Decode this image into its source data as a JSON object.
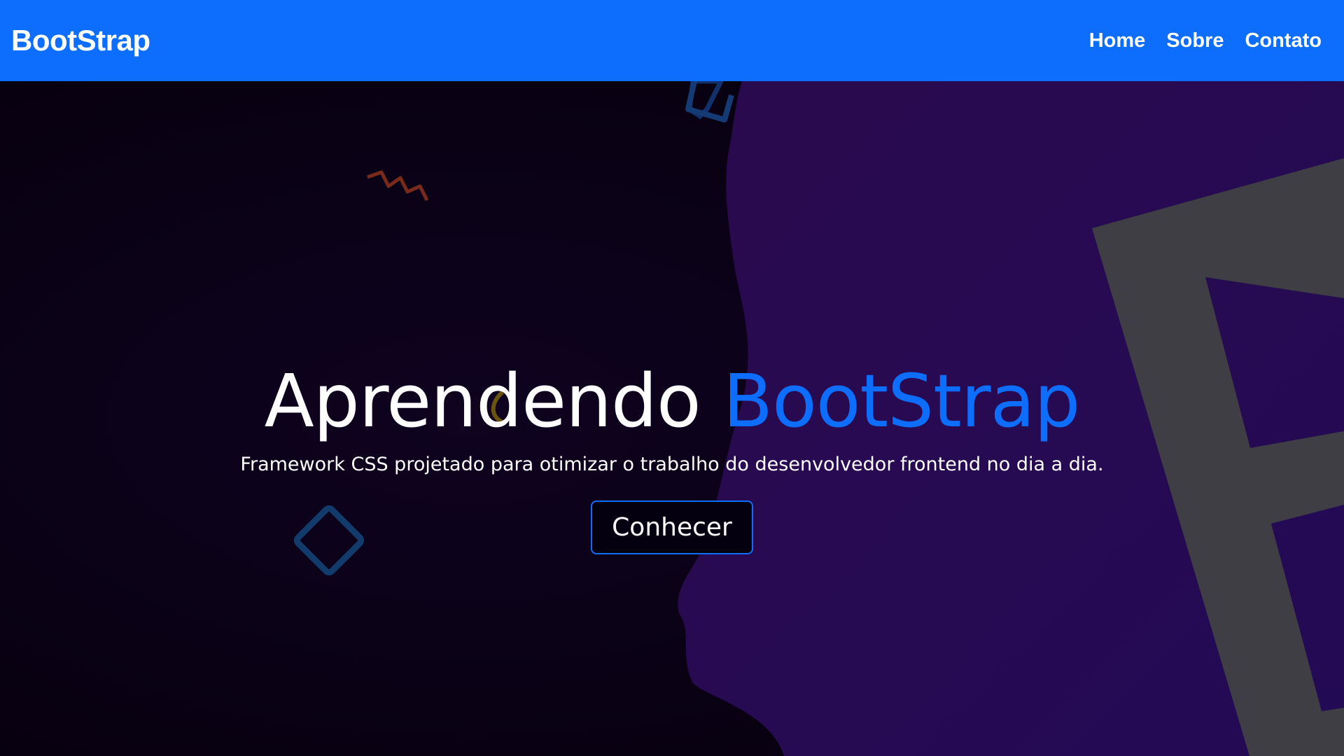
{
  "navbar": {
    "brand": "BootStrap",
    "links": [
      {
        "label": "Home"
      },
      {
        "label": "Sobre"
      },
      {
        "label": "Contato"
      }
    ],
    "background_color": "#0d6efd"
  },
  "hero": {
    "title_main": "Aprendendo",
    "title_accent": "BootStrap",
    "subtitle": "Framework CSS projetado para otimizar o trabalho do desenvolvedor frontend no dia a dia.",
    "button_label": "Conhecer",
    "accent_color": "#0d6efd",
    "background_color": "#0b0214",
    "decor_color": "#2a0a4a"
  }
}
